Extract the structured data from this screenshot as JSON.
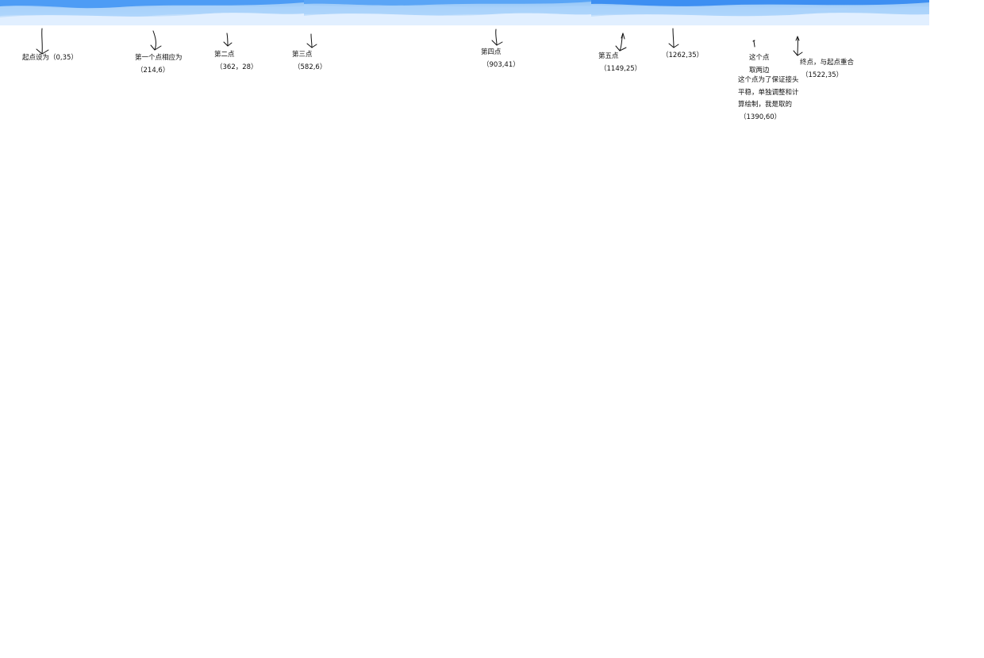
{
  "colors": {
    "wave_light": "#d9ebff",
    "wave_mid": "#a9d2fb",
    "wave_dark": "#4d9cf5",
    "ink": "#111111"
  },
  "annotations": {
    "start": {
      "text": "起点设为（0,35）"
    },
    "p1": {
      "text": "第一个点相应为",
      "coord": "（214,6）"
    },
    "p2": {
      "text": "第二点",
      "coord": "（362，28）"
    },
    "p3": {
      "text": "第三点",
      "coord": "（582,6）"
    },
    "p4": {
      "text": "第四点",
      "coord": "（903,41）"
    },
    "p5": {
      "text": "第五点",
      "coord": "（1149,25）"
    },
    "p6": {
      "coord": "（1262,35）"
    },
    "p7": {
      "line1": "这个点",
      "line2": "取两边",
      "line3": "这个点为了保证接头",
      "line4": "平稳，单独调整和计",
      "line5": "算绘制，我是取的",
      "coord": "（1390,60）"
    },
    "end": {
      "text": "终点，与起点重合",
      "coord": "（1522,35）"
    }
  }
}
